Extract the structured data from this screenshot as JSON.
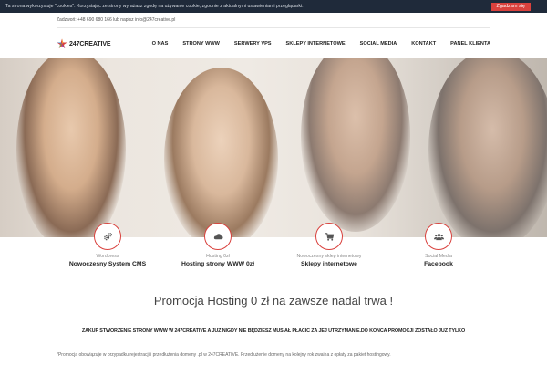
{
  "cookie_bar": {
    "text": "Ta strona wykorzystuje \"cookies\". Korzystając ze strony wyrażasz zgodę na używanie cookie, zgodnie z aktualnymi ustawieniami przeglądarki.",
    "button_label": "Zgadzam się"
  },
  "contact": {
    "text": "Zadzwoń: +48 690 680 166 lub napisz info@247creative.pl"
  },
  "logo": {
    "text": "247CREATIVE"
  },
  "nav": {
    "items": [
      {
        "label": "O NAS"
      },
      {
        "label": "STRONY WWW"
      },
      {
        "label": "SERWERY VPS"
      },
      {
        "label": "SKLEPY INTERNETOWE"
      },
      {
        "label": "SOCIAL MEDIA"
      },
      {
        "label": "KONTAKT"
      },
      {
        "label": "PANEL KLIENTA"
      }
    ]
  },
  "features": [
    {
      "icon": "gears-icon",
      "sub": "Wordpress",
      "title": "Nowoczesny System CMS"
    },
    {
      "icon": "cloud-icon",
      "sub": "Hosting 0zł",
      "title": "Hosting strony WWW 0zł"
    },
    {
      "icon": "cart-icon",
      "sub": "Nowoczesny sklep internetowy",
      "title": "Sklepy internetowe"
    },
    {
      "icon": "users-icon",
      "sub": "Social Media",
      "title": "Facebook"
    }
  ],
  "promo": {
    "title": "Promocja Hosting 0 zł na zawsze nadal trwa !",
    "line": "ZAKUP STWORZENIE STRONY WWW W 247CREATIVE A JUŻ NIGDY NIE BĘDZIESZ MUSIAŁ PŁACIĆ ZA JEJ UTRZYMANIE.DO KOŃCA PROMOCJI ZOSTAŁO JUŻ TYLKO",
    "footnote": "*Promocja obowiązuje w przypadku rejestracji i przedłużenia domeny .pl w 247CREATIVE. Przedłużenie domeny na kolejny rok zwaina z opłaty za pakiet hostingowy."
  },
  "colors": {
    "accent": "#d9413d",
    "cookie_bg": "#1f2a3a"
  }
}
